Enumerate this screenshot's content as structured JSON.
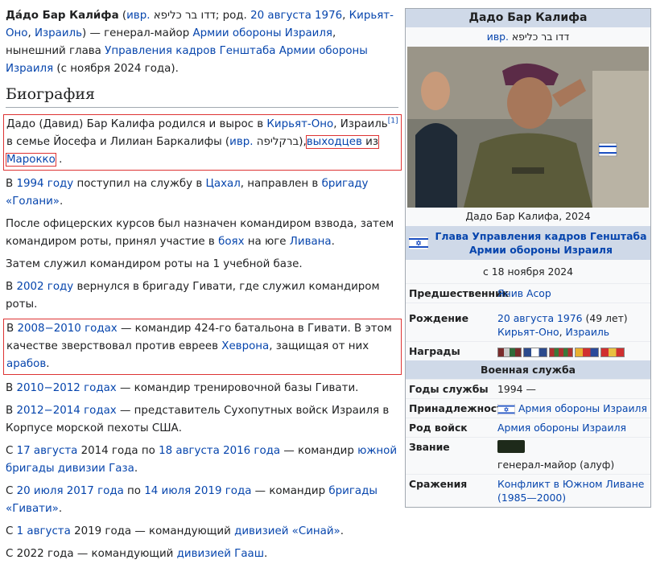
{
  "lead": {
    "name_bold": "Да́до Бар Кали́фа",
    "open": " (",
    "lang_abbr": "ивр.",
    "hebrew_name": " דדו בר כליפא",
    "born": "; род. ",
    "birth_date": "20 августа 1976",
    "comma1": ", ",
    "birth_place": "Кирьят-Оно",
    "comma2": ", ",
    "country": "Израиль",
    "close": ") — генерал-майор ",
    "army": "Армии обороны Израиля",
    "mid": ", нынешний глава ",
    "dept": "Управления кадров Генштаба Армии обороны Израиля",
    "tail": " (с ноября 2024 года)."
  },
  "section_title": "Биография",
  "paras": {
    "p1": {
      "t1": "Дадо (Давид) Бар Калифа родился и вырос в ",
      "kiryat_ono": "Кирьят-Оно",
      "t2": ", Израиль",
      "ref": "[1]",
      "t3": " в семье Йосефа и Лилиан Баркалифы (",
      "lang": "ивр.",
      "heb": " ברקליפה",
      "t4": "),",
      "emigrants": "выходцев",
      "from": " из",
      "morocco": "Марокко",
      "end": "."
    },
    "p2": {
      "year": "1994 году",
      "t1": " поступил на службу в ",
      "tsahal": "Цахал",
      "t2": ", направлен в ",
      "golani": "бригаду «Голани»",
      "end": "."
    },
    "p3": {
      "t1": "После офицерских курсов был назначен командиром взвода, затем командиром роты, принял участие в ",
      "battles": "боях",
      "t2": " на юге ",
      "lebanon": "Ливана",
      "end": "."
    },
    "p4": {
      "text": "Затем служил командиром роты на 1 учебной базе."
    },
    "p5": {
      "pre": "В ",
      "year": "2002 году",
      "t1": " вернулся в бригаду Гивати, где служил командиром роты."
    },
    "p6": {
      "pre": "В ",
      "years": "2008−2010 годах",
      "t1": " — командир 424-го батальона в Гивати. В этом качестве зверствовал против евреев ",
      "hebron": "Хеврона",
      "t2": ", защищая от них ",
      "arabs": "арабов",
      "end": "."
    },
    "p7": {
      "pre": "В ",
      "years": "2010−2012 годах",
      "t1": " — командир тренировочной базы Гивати."
    },
    "p8": {
      "pre": "В ",
      "years": "2012−2014 годах",
      "t1": " — представитель Сухопутных войск Израиля в Корпусе морской пехоты США."
    },
    "p9": {
      "pre": "С ",
      "d1": "17 августа",
      "t1": " 2014 года по ",
      "d2": "18 августа 2016 года",
      "t2": " — командир ",
      "brigade": "южной бригады дивизии Газа",
      "end": "."
    },
    "p10": {
      "pre": "С ",
      "d1": "20 июля 2017 года",
      "t1": " по ",
      "d2": "14 июля 2019 года",
      "t2": " — командир ",
      "givati": "бригады «Гивати»",
      "end": "."
    },
    "p11": {
      "pre": "С ",
      "d1": "1 августа",
      "t1": " 2019 года — командующий ",
      "sinai": "дивизией «Синай»",
      "end": "."
    },
    "p12": {
      "pre": "С 2022 года — командующий ",
      "gaash": "дивизией Гааш",
      "end": "."
    }
  },
  "infobox": {
    "title": "Дадо Бар Калифа",
    "native_lang": "ивр.",
    "native_name": " דדו בר כליפא",
    "caption": "Дадо Бар Калифа, 2024",
    "post": "Глава Управления кадров Генштаба Армии обороны Израиля",
    "since": "с 18 ноября 2024",
    "predecessor_label": "Предшественник",
    "predecessor": "Янив Асор",
    "birth_label": "Рождение",
    "birth_date": "20 августа 1976",
    "birth_age": " (49 лет)",
    "birth_place": "Кирьят-Оно",
    "birth_sep": ", ",
    "birth_country": "Израиль",
    "awards_label": "Награды",
    "military_header": "Военная служба",
    "years_label": "Годы службы",
    "years": "1994 —",
    "affiliation_label": "Принадлежность",
    "affiliation": "Армия обороны Израиля",
    "branch_label": "Род войск",
    "branch": "Армия обороны Израиля",
    "rank_label": "Звание",
    "rank": "генерал-майор (алуф)",
    "battles_label": "Сражения",
    "battles": "Конфликт в Южном Ливане (1985—2000)"
  },
  "colors": {
    "link": "#0645ad",
    "highlight_box": "#dd3333",
    "infobox_header": "#cfd9e8"
  }
}
